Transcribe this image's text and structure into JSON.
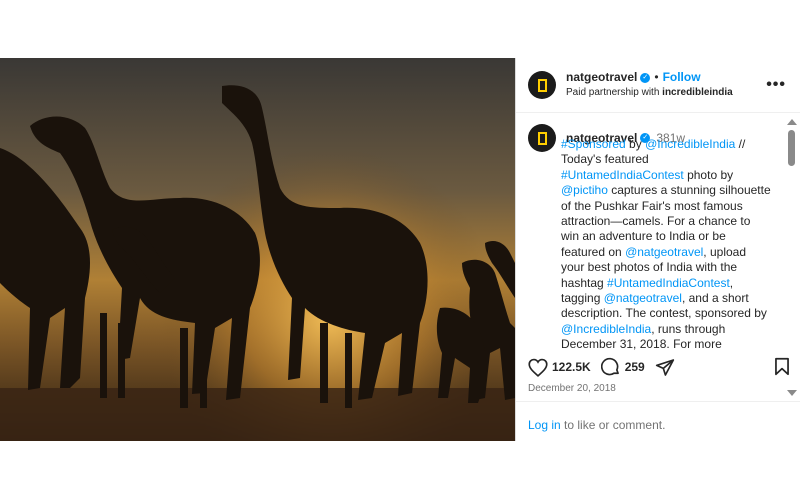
{
  "header": {
    "username": "natgeotravel",
    "separator": "•",
    "follow_label": "Follow",
    "partnership_prefix": "Paid partnership with ",
    "partner": "incredibleindia",
    "more_label": "•••"
  },
  "caption": {
    "username": "natgeotravel",
    "time": "381w",
    "segments": [
      {
        "text": "#Sponsored",
        "link": true
      },
      {
        "text": " by ",
        "link": false
      },
      {
        "text": "@IncredibleIndia",
        "link": true
      },
      {
        "text": " // Today's featured ",
        "link": false
      },
      {
        "text": "#UntamedIndiaContest",
        "link": true
      },
      {
        "text": " photo by ",
        "link": false
      },
      {
        "text": "@pictiho",
        "link": true
      },
      {
        "text": " captures a stunning silhouette of the Pushkar Fair's most famous attraction—camels. For a chance to win an adventure to India or be featured on ",
        "link": false
      },
      {
        "text": "@natgeotravel",
        "link": true
      },
      {
        "text": ", upload your best photos of India with the hashtag ",
        "link": false
      },
      {
        "text": "#UntamedIndiaContest",
        "link": true
      },
      {
        "text": ", tagging ",
        "link": false
      },
      {
        "text": "@natgeotravel",
        "link": true
      },
      {
        "text": ", and a short description. The contest, sponsored by ",
        "link": false
      },
      {
        "text": "@IncredibleIndia",
        "link": true
      },
      {
        "text": ", runs through December 31, 2018. For more",
        "link": false
      }
    ]
  },
  "actions": {
    "likes": "122.5K",
    "comments": "259",
    "like_icon": "heart-icon",
    "comment_icon": "comment-icon",
    "share_icon": "share-icon",
    "save_icon": "bookmark-icon"
  },
  "date": "December 20, 2018",
  "footer": {
    "login_label": "Log in",
    "suffix": " to like or comment."
  },
  "colors": {
    "link": "#0095f6",
    "text": "#262626",
    "muted": "#737373",
    "verified": "#0095f6"
  }
}
